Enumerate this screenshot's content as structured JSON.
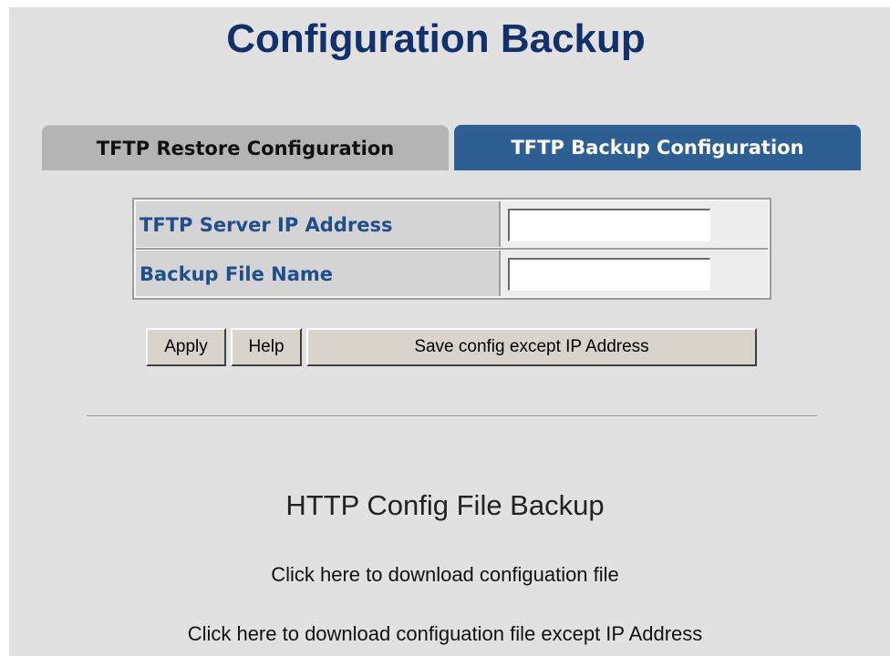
{
  "page": {
    "title": "Configuration Backup"
  },
  "tabs": [
    {
      "label": "TFTP Restore Configuration",
      "active": false
    },
    {
      "label": "TFTP Backup Configuration",
      "active": true
    }
  ],
  "form": {
    "fields": [
      {
        "label": "TFTP Server IP Address",
        "value": "",
        "placeholder": ""
      },
      {
        "label": "Backup File Name",
        "value": "",
        "placeholder": ""
      }
    ]
  },
  "buttons": {
    "apply": "Apply",
    "help": "Help",
    "save_except_ip": "Save config except IP Address"
  },
  "http_backup": {
    "title": "HTTP Config File Backup",
    "links": [
      "Click here to download configuation file",
      "Click here to download configuation file except IP Address"
    ]
  },
  "colors": {
    "title": "#12306b",
    "active_tab_bg": "#2e5f93",
    "inactive_tab_bg": "#b4b4b4",
    "field_label": "#1f4e8c",
    "page_bg": "#e1e1e1"
  }
}
